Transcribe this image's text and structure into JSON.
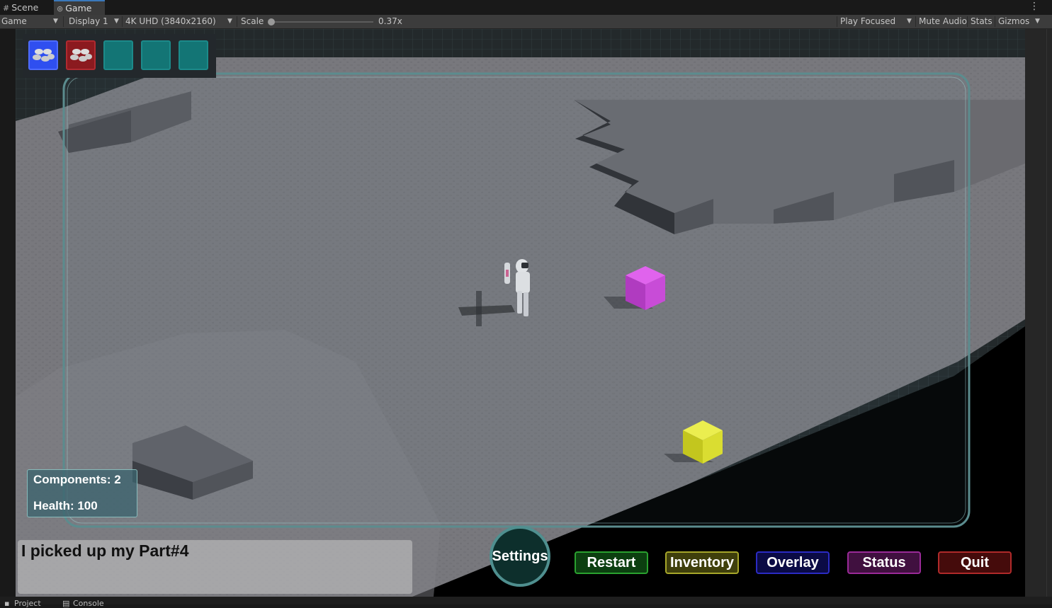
{
  "tabs": {
    "scene": "Scene",
    "game": "Game"
  },
  "toolbar": {
    "mode": "Game",
    "display": "Display 1",
    "resolution": "4K UHD (3840x2160)",
    "scale_label": "Scale",
    "scale_value": "0.37x",
    "play_focused": "Play Focused",
    "mute_audio": "Mute Audio",
    "stats": "Stats",
    "gizmos": "Gizmos"
  },
  "inventory": {
    "slots": [
      "blue",
      "red",
      "empty",
      "empty",
      "empty"
    ],
    "colors": {
      "blue": "#2f4ff0",
      "red": "#8b1a1f",
      "empty": "#137575"
    }
  },
  "hud": {
    "components_label": "Components: 2",
    "health_label": "Health: 100"
  },
  "message": "I picked up my Part#4",
  "buttons": {
    "settings": "Settings",
    "restart": "Restart",
    "inventory": "Inventory",
    "overlay": "Overlay",
    "status": "Status",
    "quit": "Quit"
  },
  "bottom_tabs": {
    "project": "Project",
    "console": "Console"
  },
  "scene_objects": {
    "cube_magenta": "#c43ad0",
    "cube_yellow": "#e2e21c"
  }
}
